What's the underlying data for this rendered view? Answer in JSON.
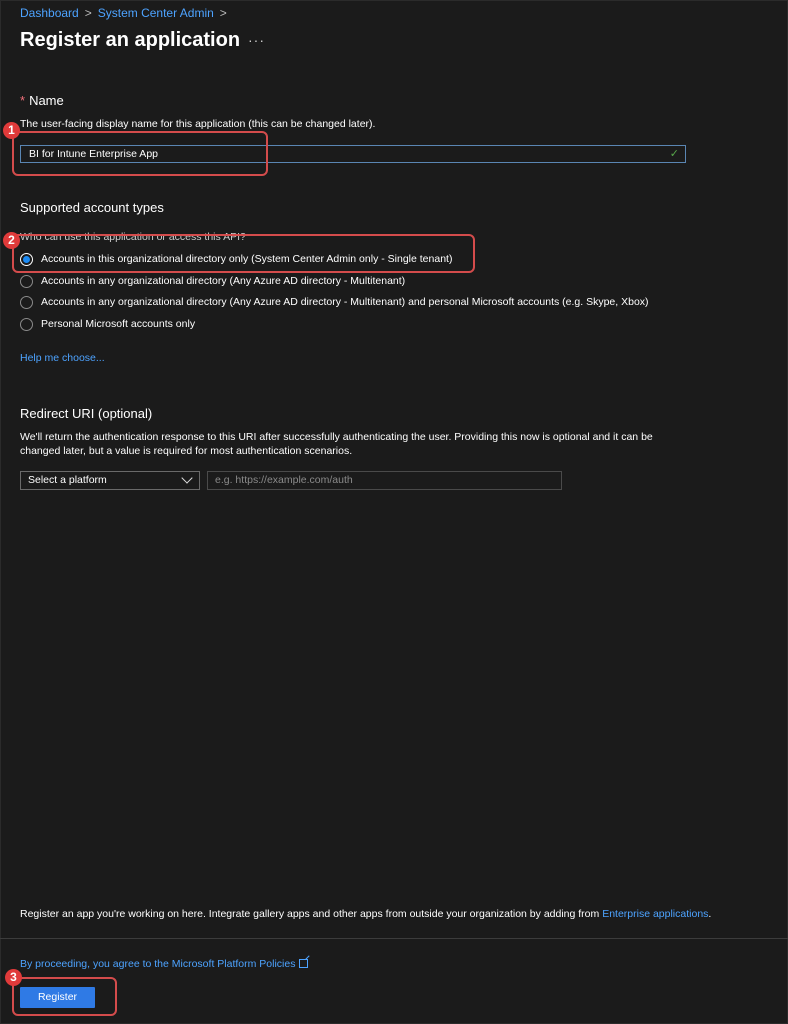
{
  "breadcrumb": {
    "items": [
      "Dashboard",
      "System Center Admin"
    ],
    "sep": ">"
  },
  "header": {
    "title": "Register an application",
    "more": "···"
  },
  "name_section": {
    "required_mark": "*",
    "title": "Name",
    "description": "The user-facing display name for this application (this can be changed later).",
    "value": "BI for Intune Enterprise App",
    "valid_icon": "checkmark-icon"
  },
  "account_types": {
    "title": "Supported account types",
    "question": "Who can use this application or access this API?",
    "options": [
      {
        "label": "Accounts in this organizational directory only (System Center Admin only - Single tenant)",
        "selected": true
      },
      {
        "label": "Accounts in any organizational directory (Any Azure AD directory - Multitenant)",
        "selected": false
      },
      {
        "label": "Accounts in any organizational directory (Any Azure AD directory - Multitenant) and personal Microsoft accounts (e.g. Skype, Xbox)",
        "selected": false
      },
      {
        "label": "Personal Microsoft accounts only",
        "selected": false
      }
    ],
    "help_link": "Help me choose..."
  },
  "redirect": {
    "title": "Redirect URI (optional)",
    "description_line1": "We'll return the authentication response to this URI after successfully authenticating the user. Providing this now is optional and it can be",
    "description_line2": "changed later, but a value is required for most authentication scenarios.",
    "platform_select": "Select a platform",
    "uri_placeholder": "e.g. https://example.com/auth"
  },
  "footer": {
    "note": "Register an app you're working on here. Integrate gallery apps and other apps from outside your organization by adding from ",
    "note_link": "Enterprise applications",
    "note_end": ".",
    "policy_link": "By proceeding, you agree to the Microsoft Platform Policies",
    "register_label": "Register"
  },
  "callouts": [
    "1",
    "2",
    "3"
  ],
  "colors": {
    "accent": "#2f7ae5",
    "link": "#4da3ff",
    "callout": "#d44c4c",
    "background": "#1b1b1b"
  }
}
